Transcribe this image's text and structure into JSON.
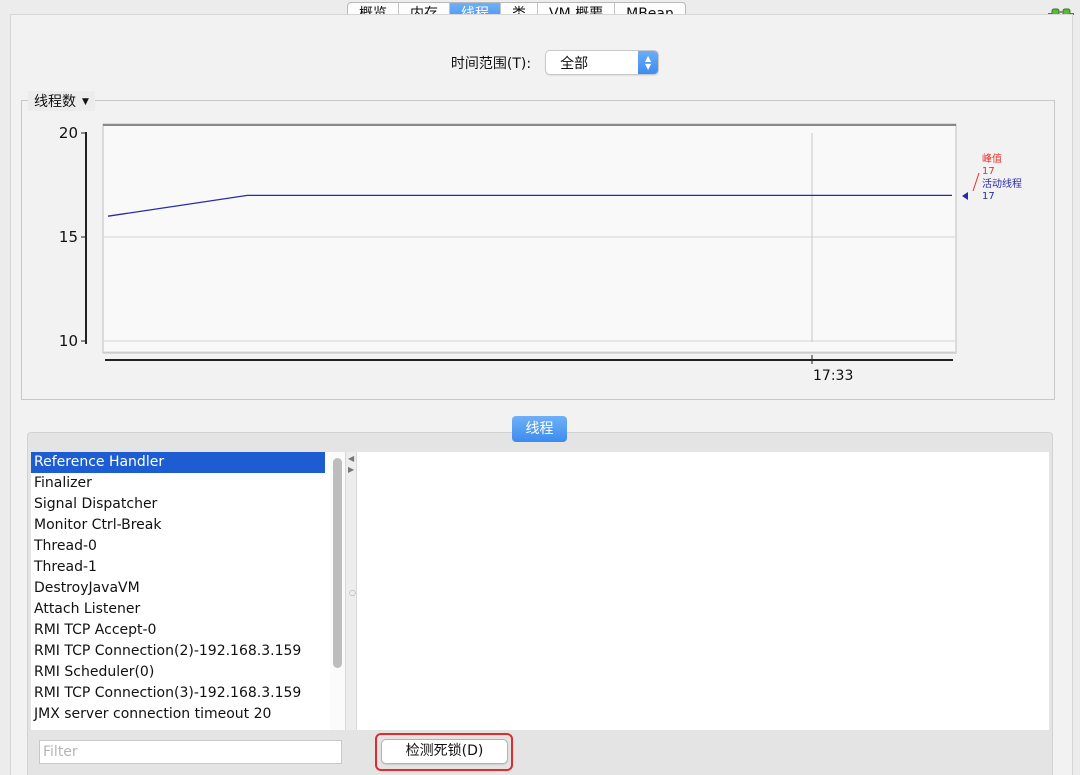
{
  "tabs": [
    "概览",
    "内存",
    "线程",
    "类",
    "VM 概要",
    "MBean"
  ],
  "active_tab": "线程",
  "icons": {
    "connection": "plug-connected-icon"
  },
  "time_range": {
    "label": "时间范围(T):",
    "selected": "全部"
  },
  "chart_panel": {
    "title": "线程数"
  },
  "legend": {
    "peak": {
      "label": "峰值",
      "value": "17",
      "color": "#e8302a"
    },
    "live": {
      "label": "活动线程",
      "value": "17",
      "color": "#2a2aa8"
    }
  },
  "chart_data": {
    "type": "line",
    "title": "线程数",
    "yticks": [
      "20",
      "15",
      "10"
    ],
    "ylim": [
      10,
      20
    ],
    "xticks": [
      "17:33"
    ],
    "grid": true,
    "series": [
      {
        "name": "活动线程",
        "points": [
          [
            0,
            16
          ],
          [
            0.165,
            17
          ],
          [
            0.33,
            17
          ],
          [
            0.5,
            17
          ],
          [
            0.665,
            17
          ],
          [
            0.83,
            17
          ],
          [
            1,
            17
          ]
        ]
      }
    ]
  },
  "threads_section": {
    "label": "线程"
  },
  "threads": [
    "Reference Handler",
    "Finalizer",
    "Signal Dispatcher",
    "Monitor Ctrl-Break",
    "Thread-0",
    "Thread-1",
    "DestroyJavaVM",
    "Attach Listener",
    "RMI TCP Accept-0",
    "RMI TCP Connection(2)-192.168.3.159",
    "RMI Scheduler(0)",
    "RMI TCP Connection(3)-192.168.3.159",
    "JMX server connection timeout 20"
  ],
  "selected_thread": 0,
  "filter": {
    "placeholder": "Filter",
    "value": ""
  },
  "detect_button": {
    "label": "检测死锁(D)"
  }
}
